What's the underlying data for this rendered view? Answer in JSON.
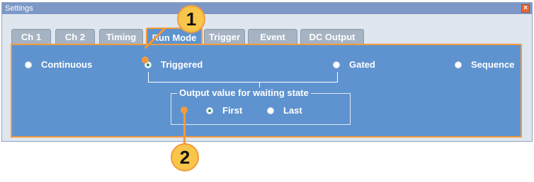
{
  "window": {
    "title": "Settings",
    "close_glyph": "×"
  },
  "tabs": [
    {
      "label": "Ch 1"
    },
    {
      "label": "Ch 2"
    },
    {
      "label": "Timing"
    },
    {
      "label": "Run Mode",
      "active": true
    },
    {
      "label": "Trigger"
    },
    {
      "label": "Event"
    },
    {
      "label": "DC Output"
    }
  ],
  "run_mode": {
    "options": [
      {
        "label": "Continuous",
        "checked": false
      },
      {
        "label": "Triggered",
        "checked": true
      },
      {
        "label": "Gated",
        "checked": false
      },
      {
        "label": "Sequence",
        "checked": false
      }
    ],
    "waiting_state": {
      "title": "Output value for waiting state",
      "options": [
        {
          "label": "First",
          "checked": true
        },
        {
          "label": "Last",
          "checked": false
        }
      ]
    }
  },
  "callouts": {
    "one": "1",
    "two": "2"
  },
  "colors": {
    "panel": "#5f93cf",
    "highlight": "#f39a3d",
    "callout_fill": "#f7c64a"
  }
}
